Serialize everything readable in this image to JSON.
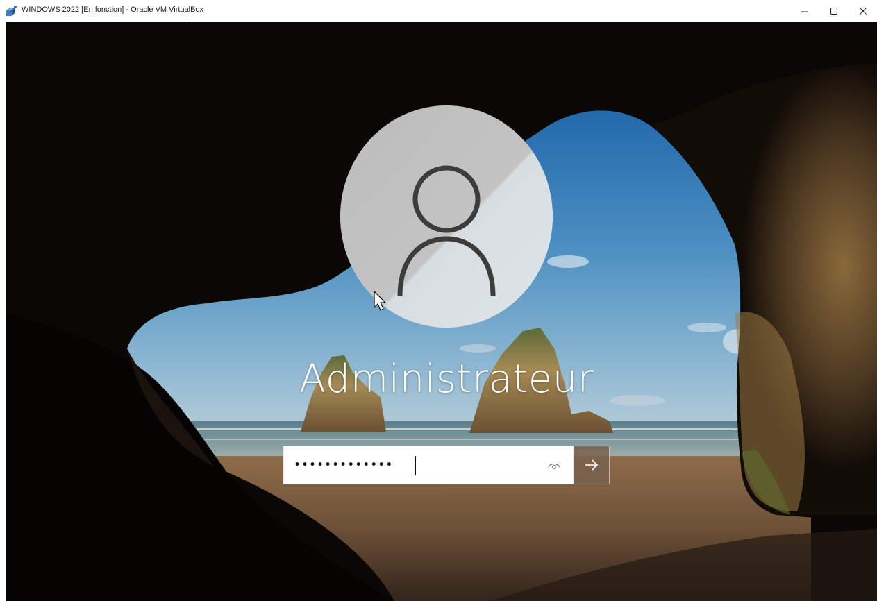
{
  "window": {
    "title": "WINDOWS 2022 [En fonction] - Oracle VM VirtualBox",
    "controls": {
      "minimize_icon": "minimize-icon",
      "maximize_icon": "maximize-icon",
      "close_icon": "close-icon"
    }
  },
  "login": {
    "username": "Administrateur",
    "password_value": "•••••••••••••",
    "reveal_icon": "eye-icon",
    "submit_icon": "arrow-right-icon"
  },
  "colors": {
    "submit_bg": "#78624e",
    "field_bg": "#ffffff",
    "username_text": "#ffffff"
  }
}
